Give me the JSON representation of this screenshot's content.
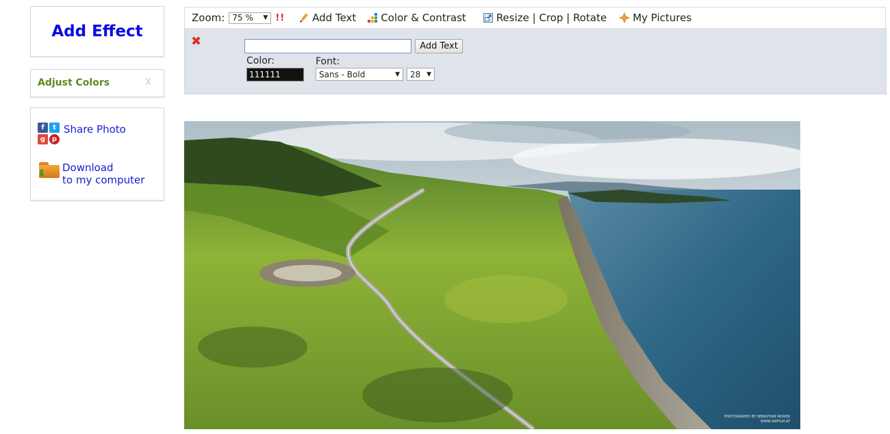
{
  "sidebar": {
    "add_effect": "Add Effect",
    "adjust_colors": "Adjust Colors",
    "adjust_close": "X",
    "share_label": "Share Photo",
    "download_line1": "Download",
    "download_line2": "to my computer"
  },
  "toolbar": {
    "zoom_label": "Zoom:",
    "zoom_value": "75 %",
    "zoom_warning": "!!",
    "add_text": "Add Text",
    "color_contrast": "Color & Contrast",
    "resize": "Resize | Crop | Rotate",
    "my_pictures": "My Pictures"
  },
  "text_panel": {
    "input_value": "",
    "add_button": "Add Text",
    "color_label": "Color:",
    "color_value": "111111",
    "font_label": "Font:",
    "font_value": "Sans - Bold",
    "size_value": "28"
  },
  "photo": {
    "watermark_line1": "PHOTOGRAPHY BY SEBASTIAN WOREK",
    "watermark_line2": "WWW.SWFILM.AT"
  },
  "colors": {
    "brand_blue": "#0a0ae6",
    "adjust_green": "#5c8a1e",
    "link_blue": "#1a1ad4",
    "panel_bg": "#dfe3ea"
  }
}
